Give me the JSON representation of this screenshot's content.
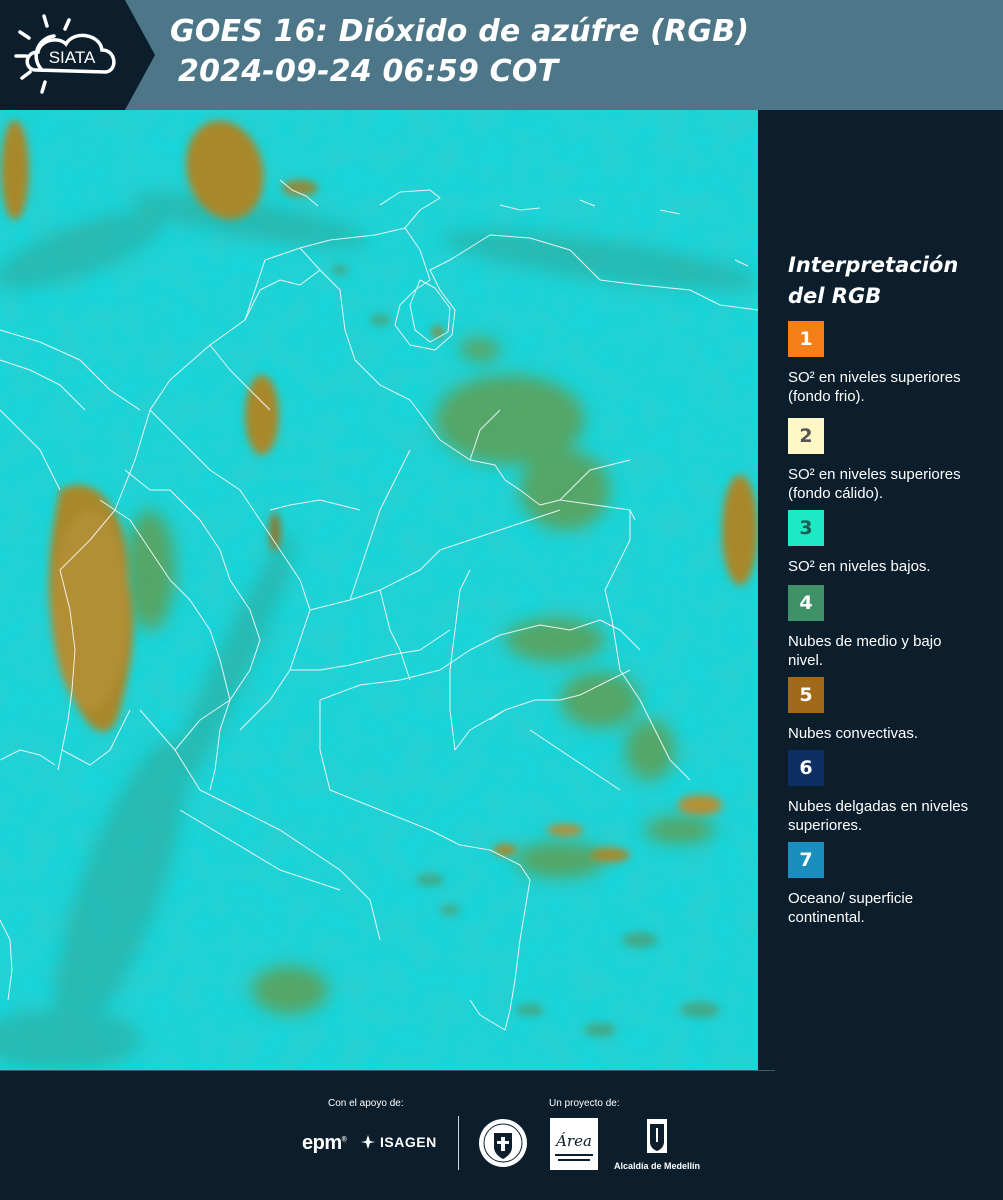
{
  "header": {
    "logo_text": "SIATA",
    "title_line1": "GOES 16: Dióxido de azúfre (RGB)",
    "title_line2": "2024-09-24 06:59 COT"
  },
  "legend": {
    "title": "Interpretación del RGB",
    "items": [
      {
        "number": "1",
        "color": "#f57f17",
        "text_color": "#ffffff",
        "label": "SO² en niveles superiores (fondo frio)."
      },
      {
        "number": "2",
        "color": "#fff8c5",
        "text_color": "#555555",
        "label": "SO² en niveles superiores (fondo cálido)."
      },
      {
        "number": "3",
        "color": "#1de9c4",
        "text_color": "#1b5e55",
        "label": "SO² en niveles bajos."
      },
      {
        "number": "4",
        "color": "#3f9167",
        "text_color": "#ffffff",
        "label": "Nubes de medio y bajo nivel."
      },
      {
        "number": "5",
        "color": "#a06a1a",
        "text_color": "#ffffff",
        "label": "Nubes convectivas."
      },
      {
        "number": "6",
        "color": "#0d2f63",
        "text_color": "#ffffff",
        "label": "Nubes delgadas en niveles superiores."
      },
      {
        "number": "7",
        "color": "#1a8fbd",
        "text_color": "#ffffff",
        "label": "Oceano/ superficie continental."
      }
    ]
  },
  "footer": {
    "support_label": "Con el apoyo de:",
    "project_label": "Un proyecto de:",
    "epm": "epm",
    "isagen": "ISAGEN",
    "area_text": "Área",
    "alcaldia": "Alcaldía de Medellín"
  },
  "map": {
    "background_color": "#19d4d8",
    "convective_color": "#a8882c",
    "midcloud_color": "#5f9f55",
    "border_color": "#f2f7f7"
  }
}
